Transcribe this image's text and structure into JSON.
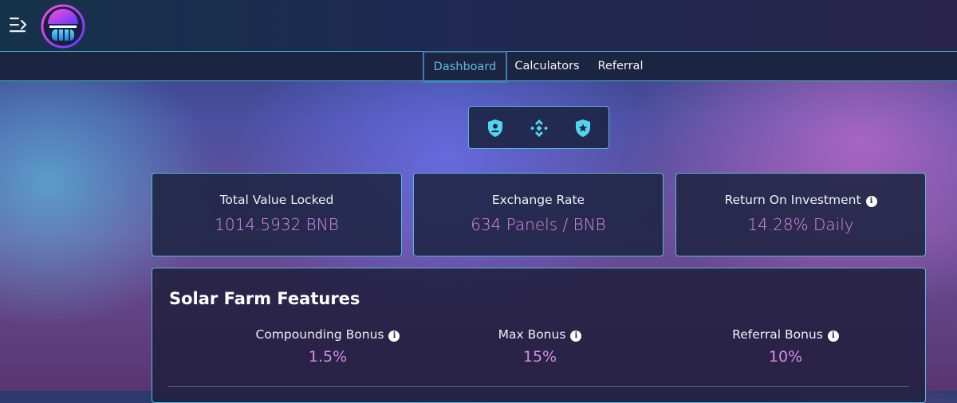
{
  "nav": {
    "items": [
      {
        "label": "Dashboard",
        "active": true
      },
      {
        "label": "Calculators",
        "active": false
      },
      {
        "label": "Referral",
        "active": false
      }
    ]
  },
  "icons": [
    "user-shield-icon",
    "binance-icon",
    "star-shield-icon"
  ],
  "stats": [
    {
      "label": "Total Value Locked",
      "value": "1014.5932 BNB",
      "info": false
    },
    {
      "label": "Exchange Rate",
      "value": "634 Panels / BNB",
      "info": false
    },
    {
      "label": "Return On Investment",
      "value": "14.28% Daily",
      "info": true
    }
  ],
  "features": {
    "title": "Solar Farm Features",
    "items": [
      {
        "label": "Compounding Bonus",
        "value": "1.5%"
      },
      {
        "label": "Max Bonus",
        "value": "15%"
      },
      {
        "label": "Referral Bonus",
        "value": "10%"
      }
    ]
  },
  "colors": {
    "accent": "#58b6d8",
    "value": "#d98ae3",
    "active_nav": "#5fb7e2"
  }
}
